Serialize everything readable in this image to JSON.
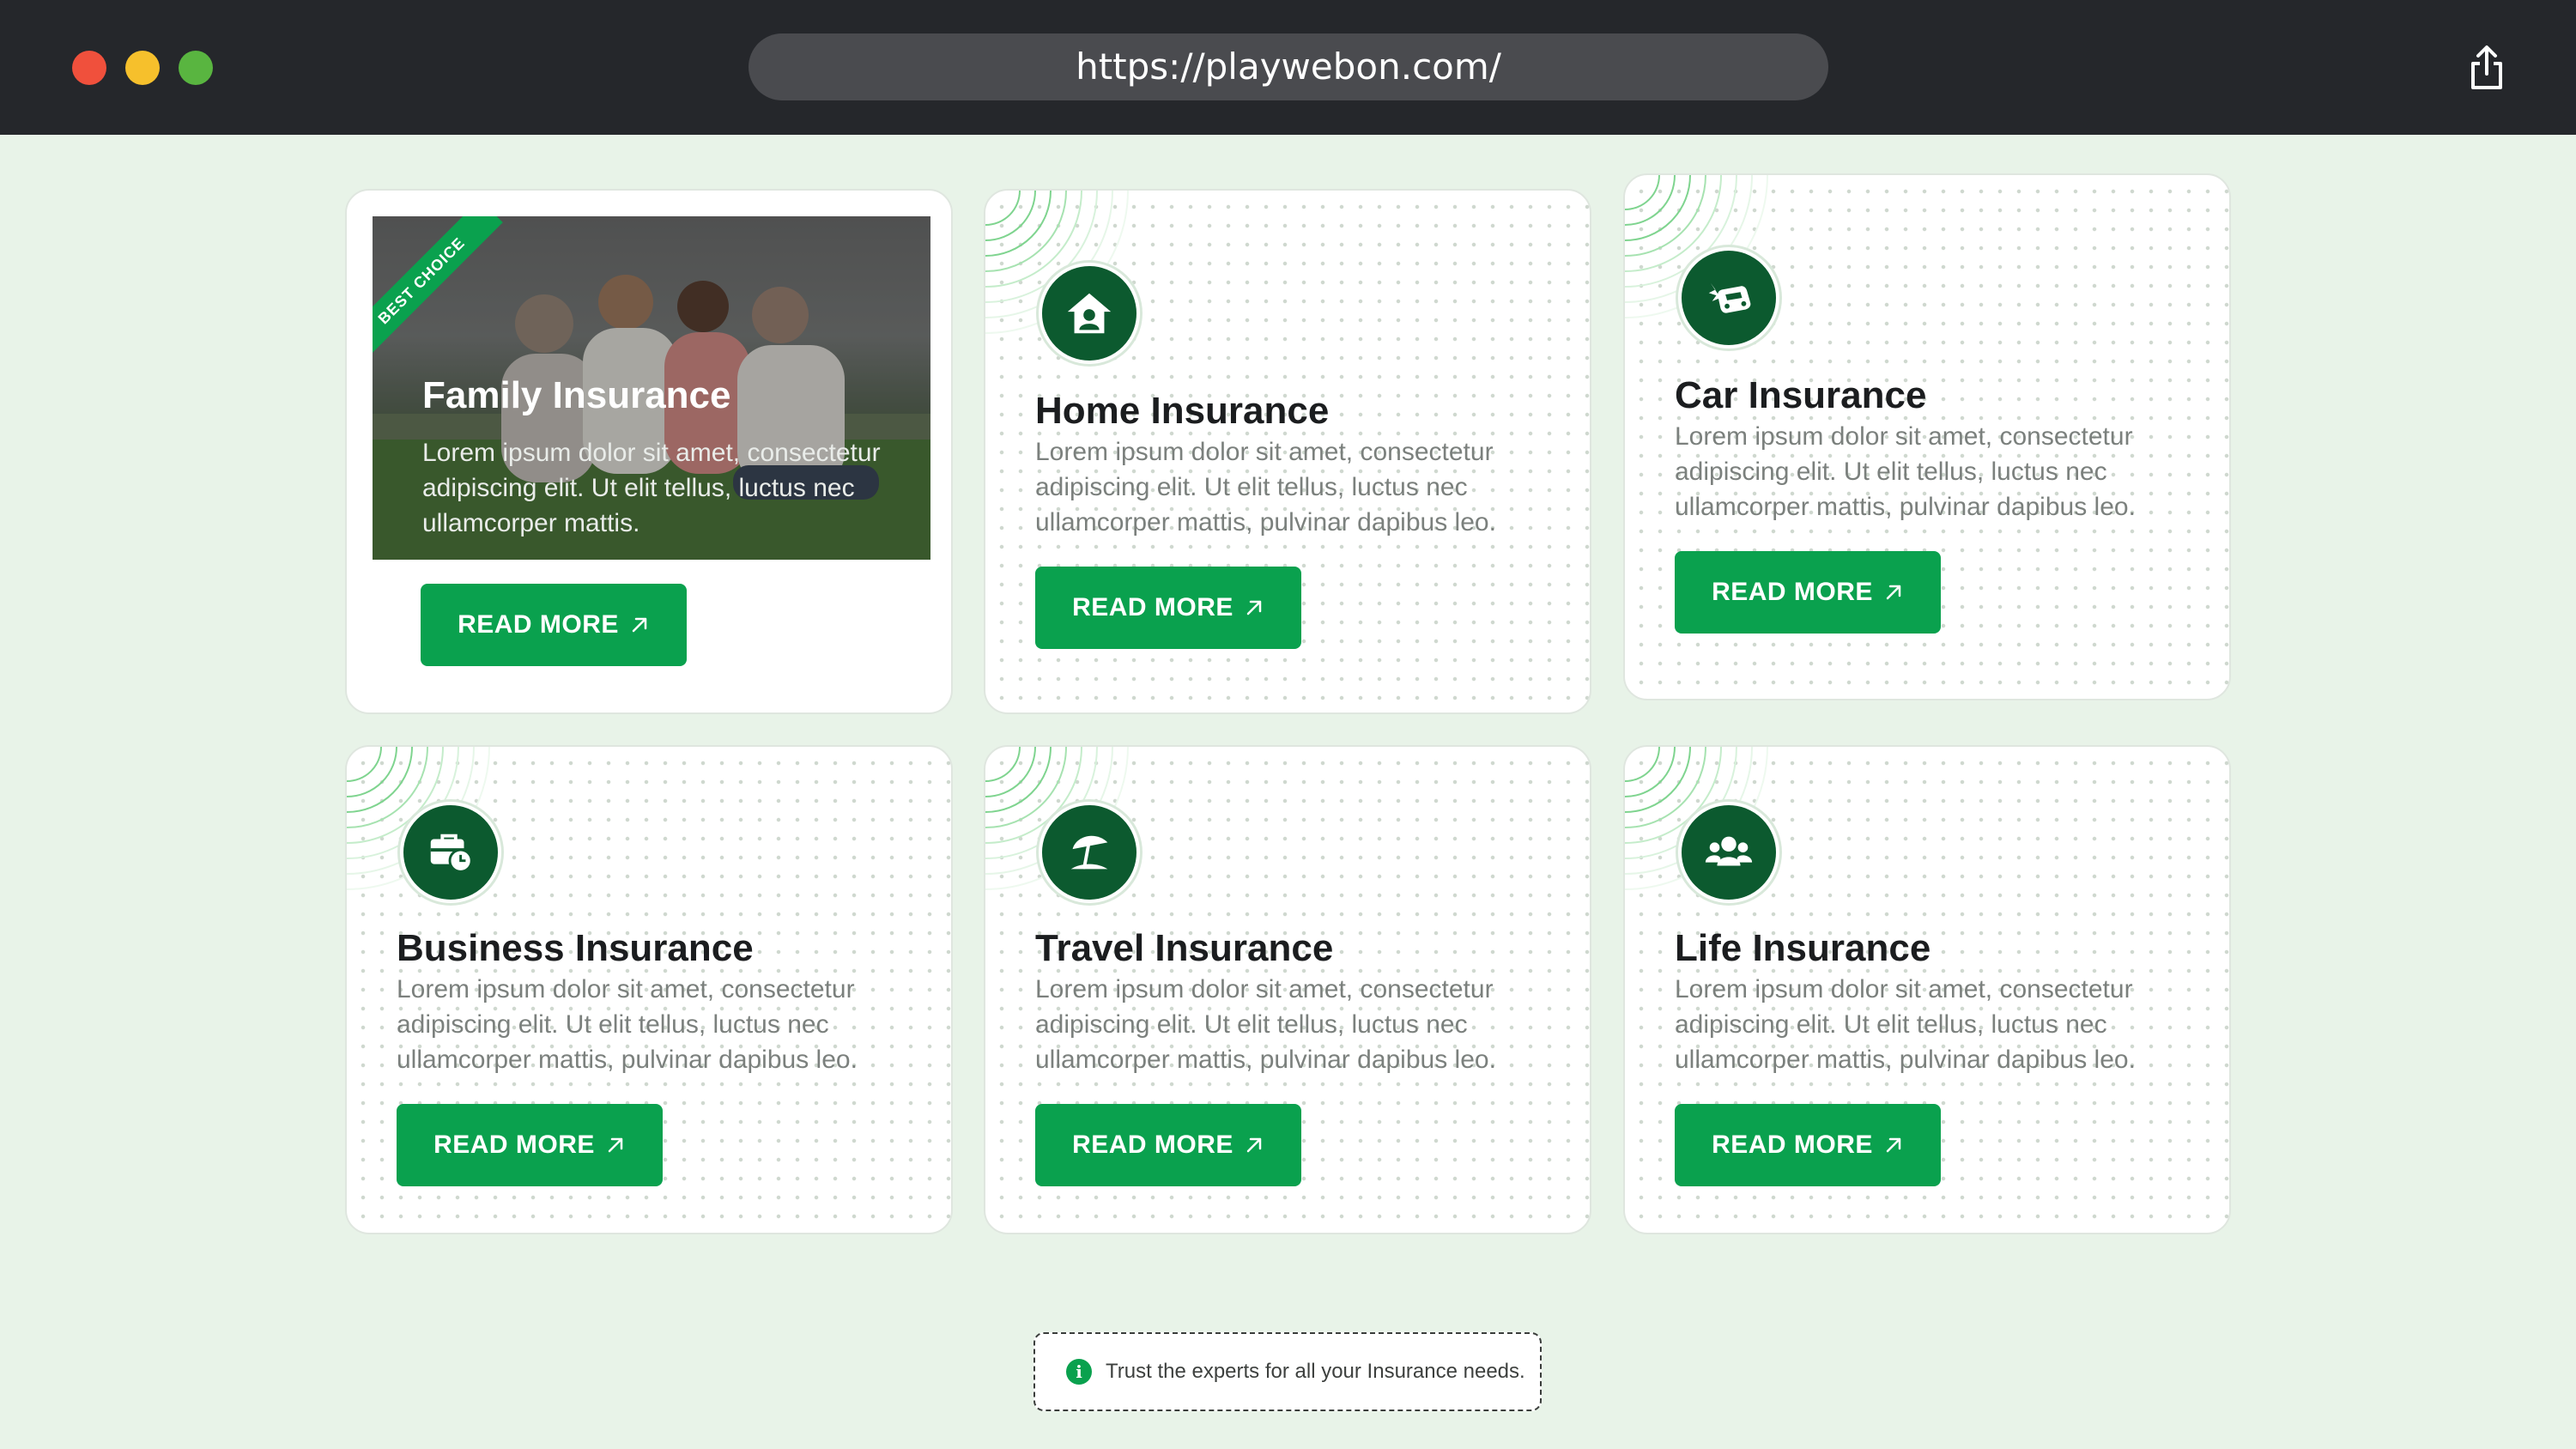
{
  "browser": {
    "url": "https://playwebon.com/",
    "colors": {
      "chrome_bg": "#25272b",
      "close": "#f0503c",
      "minimize": "#f6c02c",
      "maximize": "#59b540"
    }
  },
  "cards": {
    "family": {
      "ribbon": "BEST CHOICE",
      "title": "Family Insurance",
      "desc": "Lorem ipsum dolor sit amet, consectetur adipiscing elit. Ut elit tellus, luctus nec ullamcorper mattis.",
      "button": "READ MORE"
    },
    "home": {
      "icon": "house-icon",
      "title": "Home Insurance",
      "desc": "Lorem ipsum dolor sit amet, consectetur adipiscing elit. Ut elit tellus, luctus nec ullamcorper mattis, pulvinar dapibus leo.",
      "button": "READ MORE"
    },
    "car": {
      "icon": "car-crash-icon",
      "title": "Car Insurance",
      "desc": "Lorem ipsum dolor sit amet, consectetur adipiscing elit. Ut elit tellus, luctus nec ullamcorper mattis, pulvinar dapibus leo.",
      "button": "READ MORE"
    },
    "business": {
      "icon": "briefcase-clock-icon",
      "title": "Business Insurance",
      "desc": "Lorem ipsum dolor sit amet, consectetur adipiscing elit. Ut elit tellus, luctus nec ullamcorper mattis, pulvinar dapibus leo.",
      "button": "READ MORE"
    },
    "travel": {
      "icon": "beach-umbrella-icon",
      "title": "Travel Insurance",
      "desc": "Lorem ipsum dolor sit amet, consectetur adipiscing elit. Ut elit tellus, luctus nec ullamcorper mattis, pulvinar dapibus leo.",
      "button": "READ MORE"
    },
    "life": {
      "icon": "users-group-icon",
      "title": "Life Insurance",
      "desc": "Lorem ipsum dolor sit amet, consectetur adipiscing elit. Ut elit tellus, luctus nec ullamcorper mattis, pulvinar dapibus leo.",
      "button": "READ MORE"
    }
  },
  "footer": {
    "note": "Trust the experts for all your Insurance needs."
  },
  "colors": {
    "page_bg": "#e8f3e8",
    "accent": "#0aa14e",
    "icon_bg": "#0c5a2f"
  }
}
